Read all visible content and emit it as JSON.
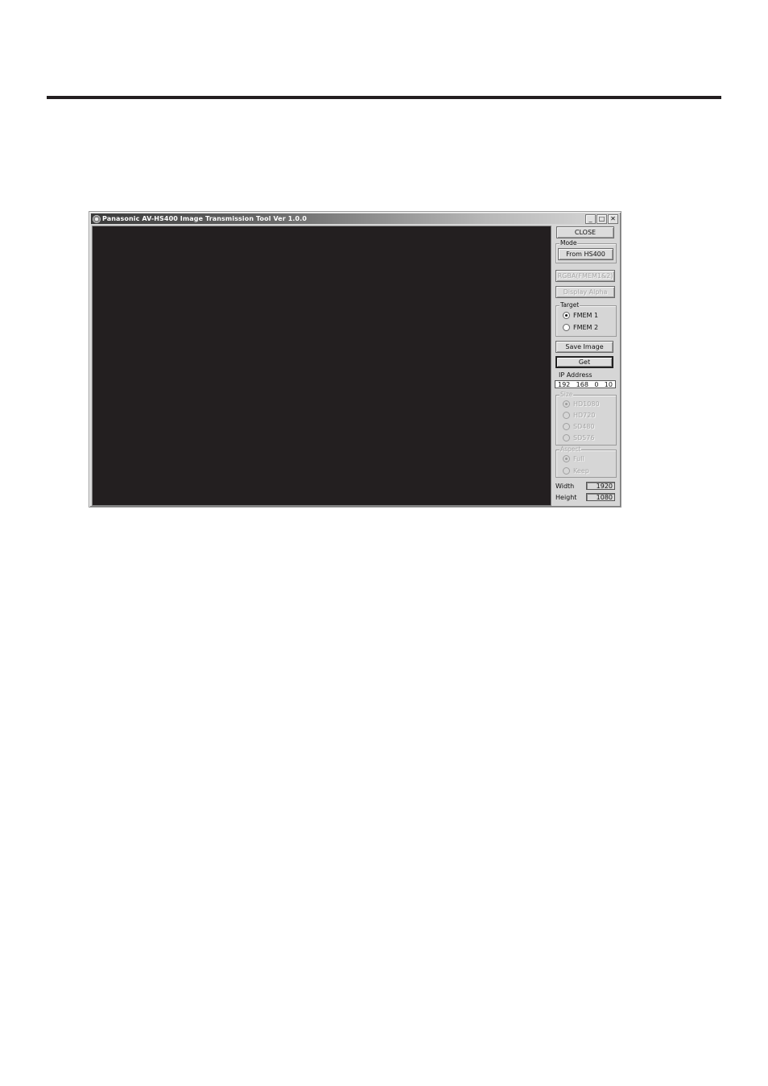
{
  "page": {
    "header_rule": true
  },
  "window": {
    "title": "Panasonic AV-HS400 Image Transmission Tool Ver 1.0.0",
    "controls": {
      "minimize": "_",
      "maximize": "□",
      "close": "✕"
    },
    "icons": {
      "app": "panasonic-app-icon"
    }
  },
  "panel": {
    "close_button": "CLOSE",
    "mode": {
      "label": "Mode",
      "button": "From HS400"
    },
    "rgba_button": "RGBA(FMEM1&2)",
    "display_alpha_button": "Display Alpha",
    "target": {
      "label": "Target",
      "options": [
        {
          "label": "FMEM 1",
          "checked": true
        },
        {
          "label": "FMEM 2",
          "checked": false
        }
      ]
    },
    "save_image_button": "Save Image",
    "get_button": "Get",
    "ip": {
      "label": "IP Address",
      "octets": [
        "192",
        "168",
        "0",
        "10"
      ]
    },
    "size": {
      "label": "Size",
      "disabled": true,
      "options": [
        {
          "label": "HD1080",
          "checked": true
        },
        {
          "label": "HD720",
          "checked": false
        },
        {
          "label": "SD480",
          "checked": false
        },
        {
          "label": "SD576",
          "checked": false
        }
      ]
    },
    "aspect": {
      "label": "Aspect",
      "disabled": true,
      "options": [
        {
          "label": "Full",
          "checked": true
        },
        {
          "label": "Keep",
          "checked": false
        }
      ]
    },
    "width": {
      "label": "Width",
      "value": "1920"
    },
    "height": {
      "label": "Height",
      "value": "1080"
    }
  },
  "colors": {
    "viewport_bg": "#231f20",
    "rule": "#231f20"
  }
}
